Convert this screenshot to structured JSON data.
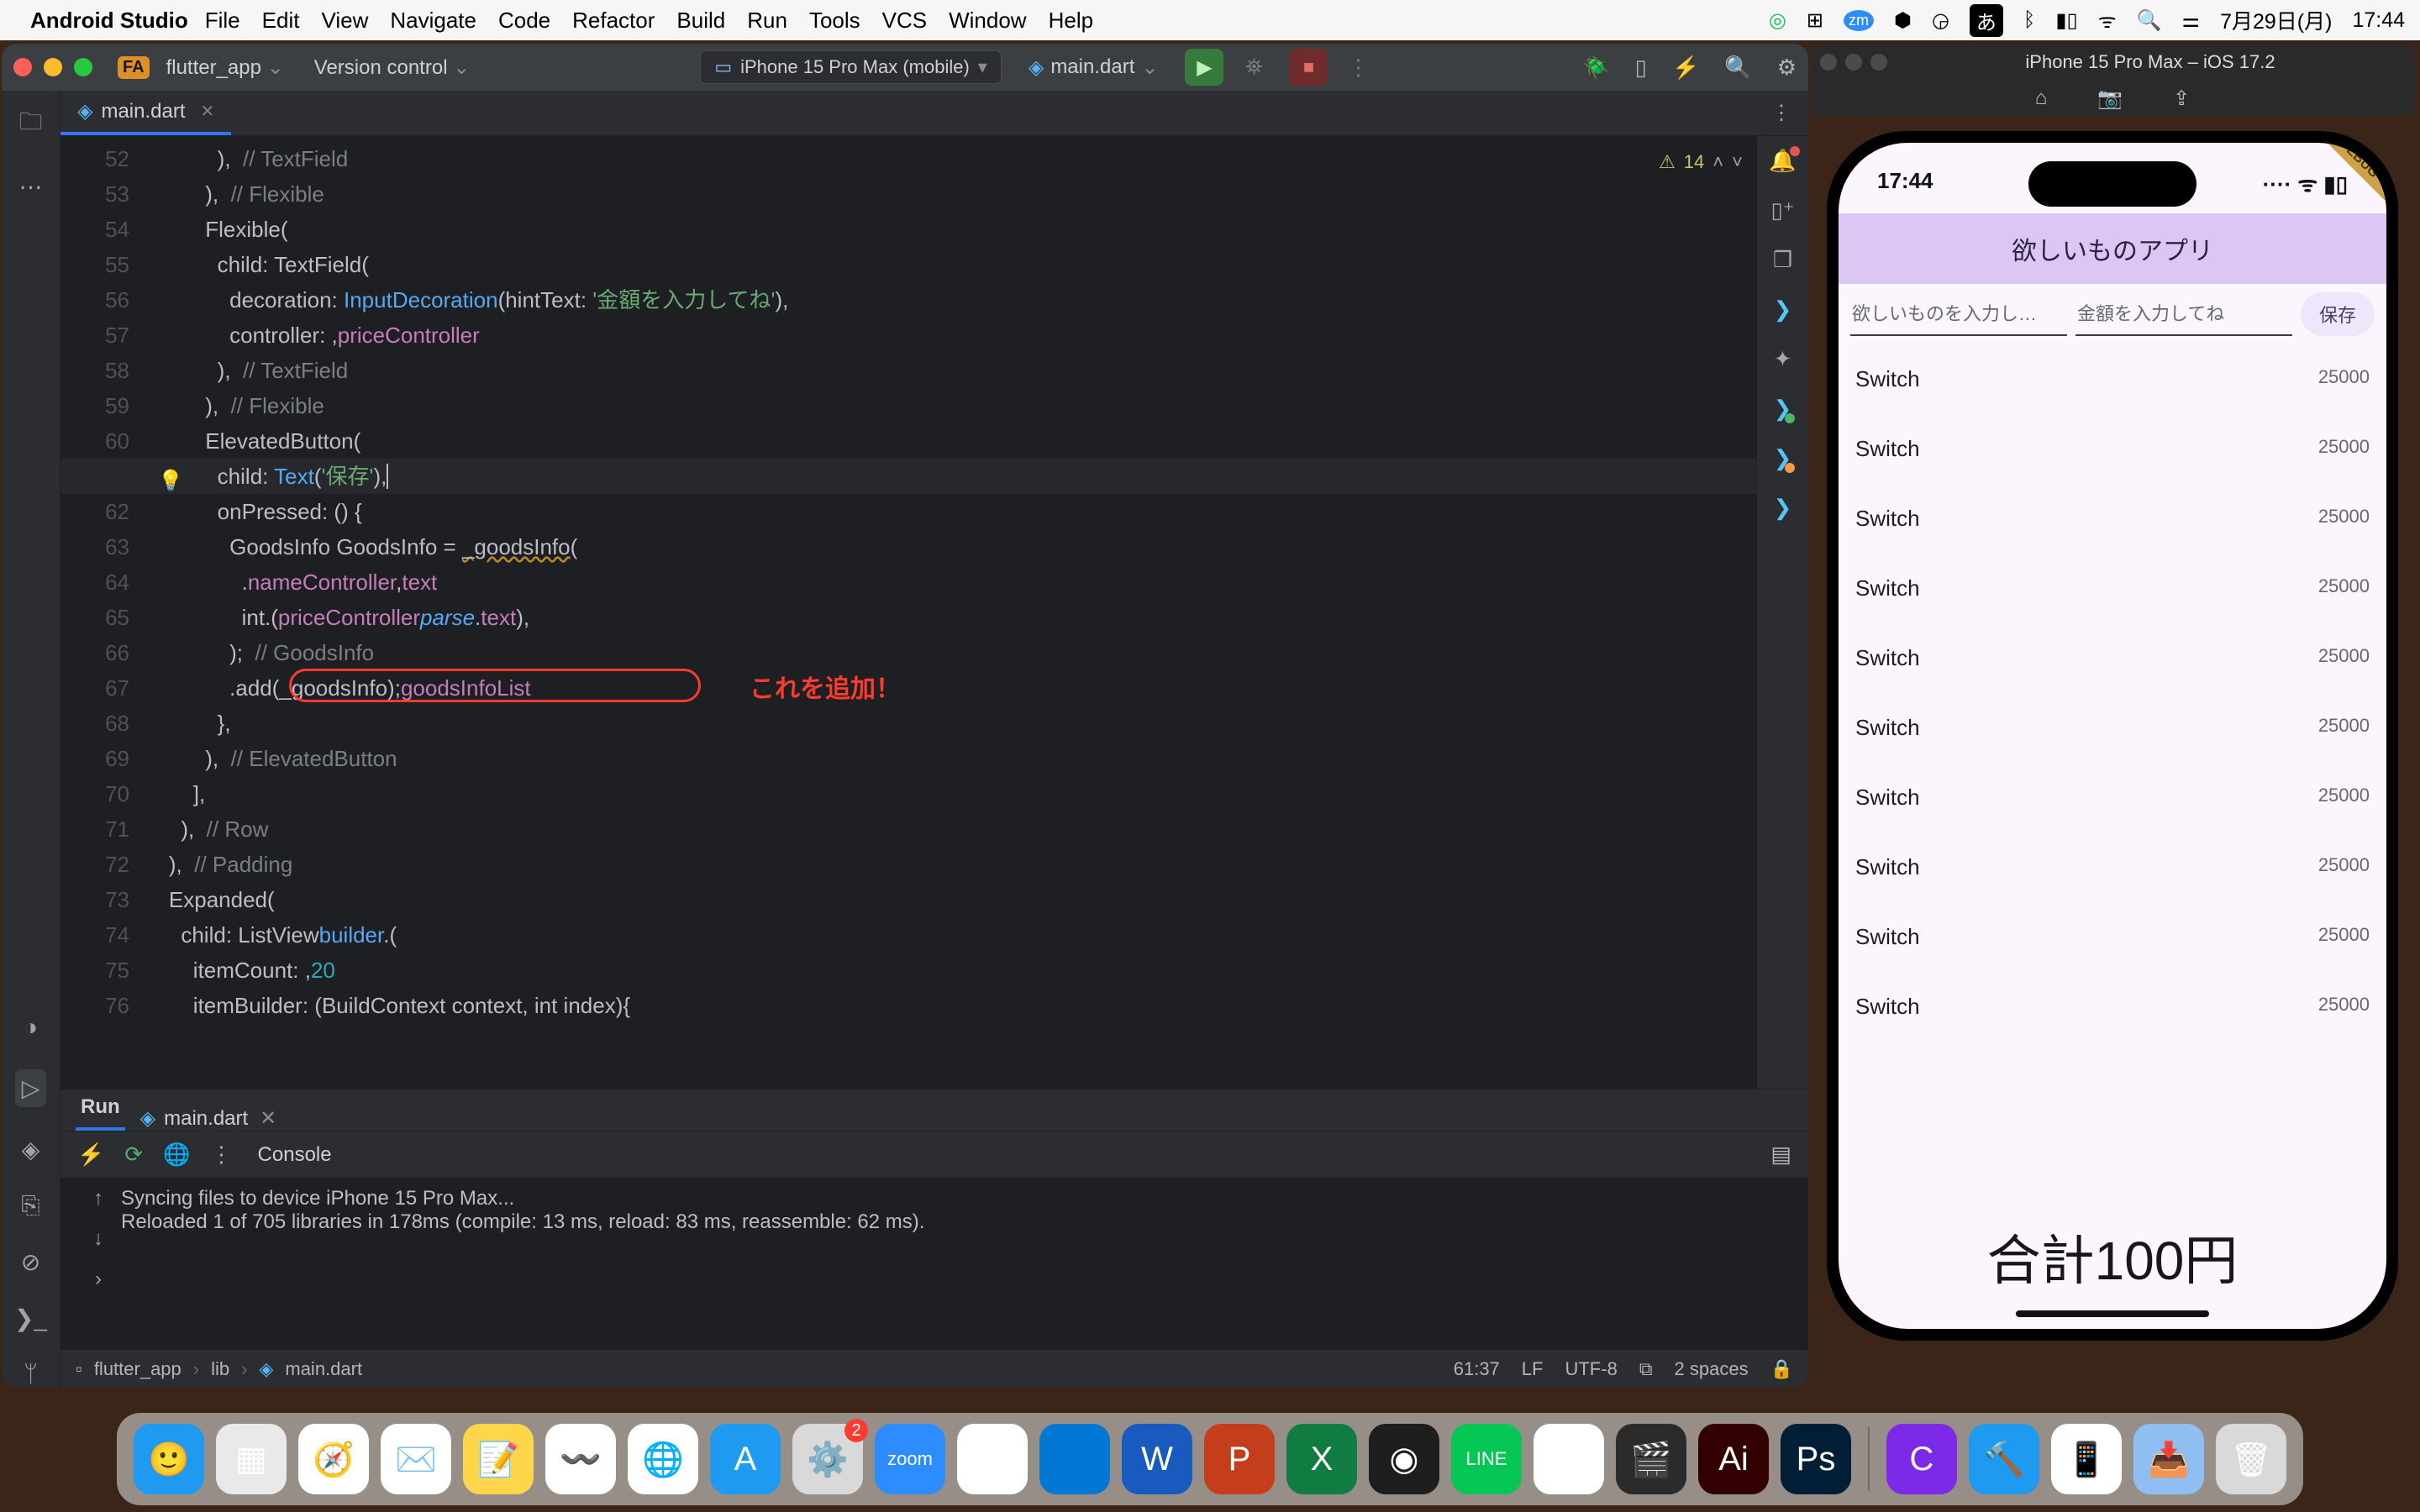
{
  "menubar": {
    "app": "Android Studio",
    "items": [
      "File",
      "Edit",
      "View",
      "Navigate",
      "Code",
      "Refactor",
      "Build",
      "Run",
      "Tools",
      "VCS",
      "Window",
      "Help"
    ],
    "ime": "あ",
    "date": "7月29日(月)",
    "time": "17:44"
  },
  "ide": {
    "project_badge": "FA",
    "project": "flutter_app",
    "vc": "Version control",
    "device": "iPhone 15 Pro Max (mobile)",
    "config": "main.dart",
    "tab": "main.dart",
    "warnings": "14",
    "gutter_start": 52,
    "current_line": 61,
    "lines": [
      {
        "t": "            ),  ",
        "c": "// TextField"
      },
      {
        "t": "          ),  ",
        "c": "// Flexible"
      },
      {
        "t": "          ",
        "cls": "Flexible",
        "t2": "("
      },
      {
        "t": "            child: ",
        "cls": "TextField",
        "t2": "("
      },
      {
        "t": "              decoration: ",
        "fn": "InputDecoration",
        "t2": "(hintText: ",
        "str": "'金額を入力してね'",
        "t3": "),"
      },
      {
        "t": "              controller: ",
        "field": "priceController",
        "t2": ","
      },
      {
        "t": "            ),  ",
        "c": "// TextField"
      },
      {
        "t": "          ),  ",
        "c": "// Flexible"
      },
      {
        "t": "          ",
        "cls": "ElevatedButton",
        "t2": "("
      },
      {
        "t": "            child: ",
        "fn": "Text",
        "t2": "(",
        "str": "'保存'",
        "t3": "),",
        "cursor": true
      },
      {
        "t": "            onPressed: () {"
      },
      {
        "t": "              GoodsInfo ",
        "u": "_goodsInfo",
        "t2": " = ",
        "cls": "GoodsInfo",
        "t3": "("
      },
      {
        "t": "                ",
        "field": "nameController",
        "t2": ".",
        "fld2": "text",
        "t3": ","
      },
      {
        "t": "                int.",
        "it": "parse",
        "t2": "(",
        "field": "priceController",
        "t3": ".",
        "fld2": "text",
        "t4": "),"
      },
      {
        "t": "              );  ",
        "c": "// GoodsInfo"
      },
      {
        "t": "              ",
        "hl": "goodsInfoList",
        "t2": ".add(_goodsInfo);"
      },
      {
        "t": "            },"
      },
      {
        "t": "          ),  ",
        "c": "// ElevatedButton"
      },
      {
        "t": "        ],"
      },
      {
        "t": "      ),  ",
        "c": "// Row"
      },
      {
        "t": "    ),  ",
        "c": "// Padding"
      },
      {
        "t": "    ",
        "cls": "Expanded",
        "t2": "("
      },
      {
        "t": "      child: ",
        "cls2": "ListView",
        "t2": ".",
        "fn": "builder",
        "t3": "("
      },
      {
        "t": "        itemCount: ",
        "num": "20",
        "t2": ","
      },
      {
        "t": "        itemBuilder: (BuildContext context, int index){"
      }
    ],
    "annotation_text": "これを追加！",
    "run": {
      "tab": "Run",
      "subtab": "main.dart",
      "console_label": "Console",
      "output": "Syncing files to device iPhone 15 Pro Max...\nReloaded 1 of 705 libraries in 178ms (compile: 13 ms, reload: 83 ms, reassemble: 62 ms)."
    },
    "status": {
      "crumbs": [
        "flutter_app",
        "lib",
        "main.dart"
      ],
      "pos": "61:37",
      "lineend": "LF",
      "enc": "UTF-8",
      "indent": "2 spaces"
    }
  },
  "sim": {
    "title": "iPhone 15 Pro Max – iOS 17.2",
    "clock": "17:44",
    "app_title": "欲しいものアプリ",
    "hint1": "欲しいものを入力し…",
    "hint2": "金額を入力してね",
    "save": "保存",
    "item_name": "Switch",
    "item_price": "25000",
    "rows": 10,
    "total": "合計100円",
    "debug": "DEBUG"
  },
  "dock": {
    "apps": [
      {
        "n": "finder",
        "bg": "#1e9bf0",
        "g": "🙂"
      },
      {
        "n": "launchpad",
        "bg": "#e9e9e9",
        "g": "▦"
      },
      {
        "n": "safari",
        "bg": "#ffffff",
        "g": "🧭"
      },
      {
        "n": "mail",
        "bg": "#ffffff",
        "g": "✉️"
      },
      {
        "n": "notes",
        "bg": "#ffd54a",
        "g": "📝"
      },
      {
        "n": "freeform",
        "bg": "#ffffff",
        "g": "〰️"
      },
      {
        "n": "chrome",
        "bg": "#ffffff",
        "g": "🌐"
      },
      {
        "n": "appstore",
        "bg": "#1e9bf0",
        "g": "A"
      },
      {
        "n": "settings",
        "bg": "#d9d9d9",
        "g": "⚙️",
        "badge": "2"
      },
      {
        "n": "zoom",
        "bg": "#2d8cff",
        "g": "zoom"
      },
      {
        "n": "slack",
        "bg": "#ffffff",
        "g": "✱"
      },
      {
        "n": "vscode",
        "bg": "#0078d4",
        "g": "</>"
      },
      {
        "n": "word",
        "bg": "#185abd",
        "g": "W"
      },
      {
        "n": "powerpoint",
        "bg": "#c43e1c",
        "g": "P"
      },
      {
        "n": "excel",
        "bg": "#107c41",
        "g": "X"
      },
      {
        "n": "figma",
        "bg": "#1e1e1e",
        "g": "◉"
      },
      {
        "n": "line",
        "bg": "#06c755",
        "g": "LINE"
      },
      {
        "n": "preview",
        "bg": "#ffffff",
        "g": "🖼"
      },
      {
        "n": "fcp",
        "bg": "#2b2b2b",
        "g": "🎬"
      },
      {
        "n": "illustrator",
        "bg": "#330000",
        "g": "Ai"
      },
      {
        "n": "photoshop",
        "bg": "#001e36",
        "g": "Ps"
      }
    ],
    "apps2": [
      {
        "n": "canva",
        "bg": "#7d2ae8",
        "g": "C"
      },
      {
        "n": "xcode",
        "bg": "#1e9bf0",
        "g": "🔨"
      },
      {
        "n": "simulator",
        "bg": "#ffffff",
        "g": "📱"
      },
      {
        "n": "downloads",
        "bg": "#8fbff2",
        "g": "📥"
      },
      {
        "n": "trash",
        "bg": "#d9d9d9",
        "g": "🗑"
      }
    ]
  }
}
